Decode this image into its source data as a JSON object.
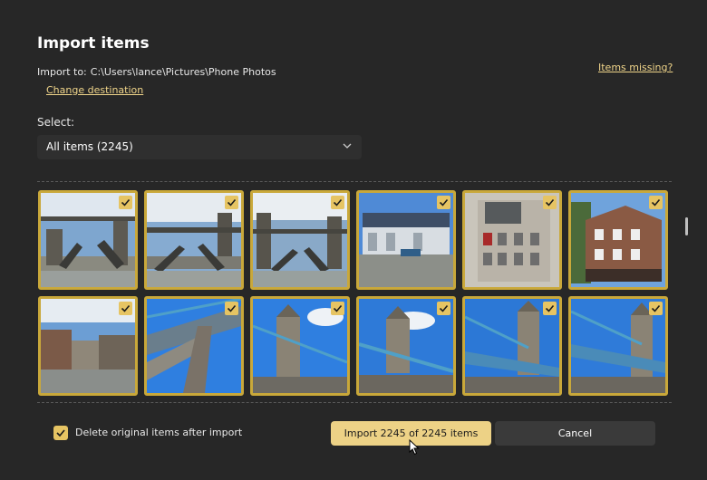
{
  "dialog": {
    "title": "Import items",
    "import_to_label": "Import to:",
    "import_to_path": "C:\\Users\\lance\\Pictures\\Phone Photos",
    "change_destination": "Change destination",
    "items_missing": "Items missing?",
    "select_label": "Select:",
    "select_value": "All items (2245)"
  },
  "thumbnails": [
    {
      "icon": "tower-bridge-photo",
      "checked": true
    },
    {
      "icon": "tower-bridge-photo",
      "checked": true
    },
    {
      "icon": "tower-bridge-photo",
      "checked": true
    },
    {
      "icon": "warehouse-riverside-photo",
      "checked": true
    },
    {
      "icon": "building-facade-photo",
      "checked": true
    },
    {
      "icon": "pub-building-photo",
      "checked": true
    },
    {
      "icon": "riverside-buildings-photo",
      "checked": true
    },
    {
      "icon": "bridge-tower-upward-photo",
      "checked": true
    },
    {
      "icon": "bridge-tower-photo",
      "checked": true
    },
    {
      "icon": "bridge-tower-photo",
      "checked": true
    },
    {
      "icon": "bridge-tower-photo",
      "checked": true
    },
    {
      "icon": "bridge-tower-photo",
      "checked": true
    }
  ],
  "footer": {
    "delete_originals_label": "Delete original items after import",
    "delete_originals_checked": true,
    "import_button": "Import 2245 of 2245 items",
    "cancel_button": "Cancel"
  },
  "colors": {
    "accent": "#edd286",
    "tile_border": "#c9a83a",
    "background": "#272727"
  }
}
